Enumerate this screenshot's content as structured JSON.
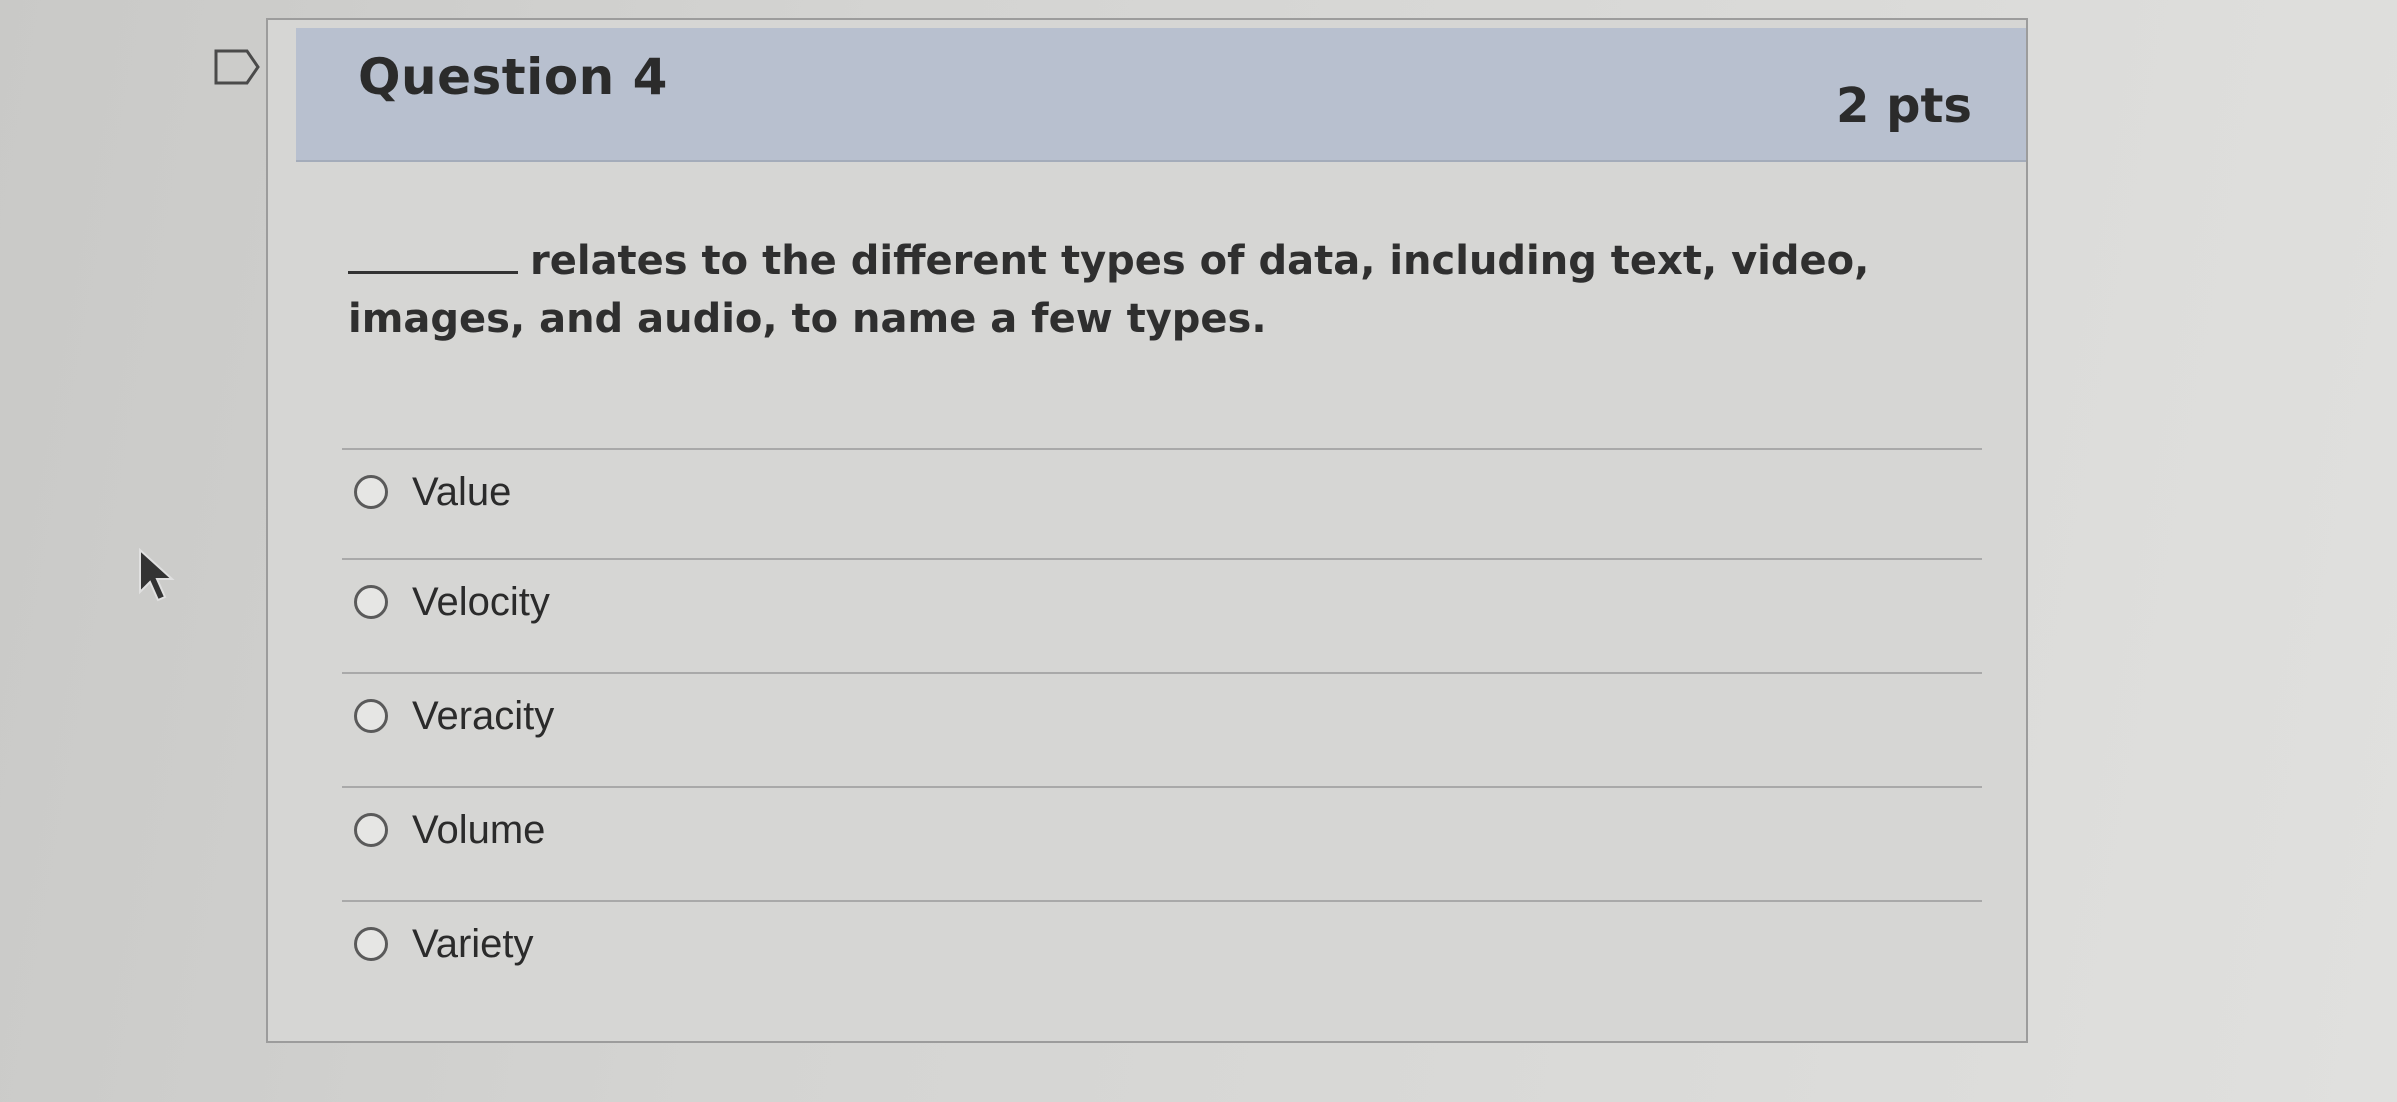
{
  "question": {
    "title": "Question 4",
    "points": "2 pts",
    "text": "relates to the different types of data, including text, video, images, and audio, to name a few types.",
    "answers": [
      {
        "label": "Value"
      },
      {
        "label": "Velocity"
      },
      {
        "label": "Veracity"
      },
      {
        "label": "Volume"
      },
      {
        "label": "Variety"
      }
    ]
  },
  "icons": {
    "flag": "flag-question-icon",
    "cursor": "mouse-pointer-icon"
  }
}
